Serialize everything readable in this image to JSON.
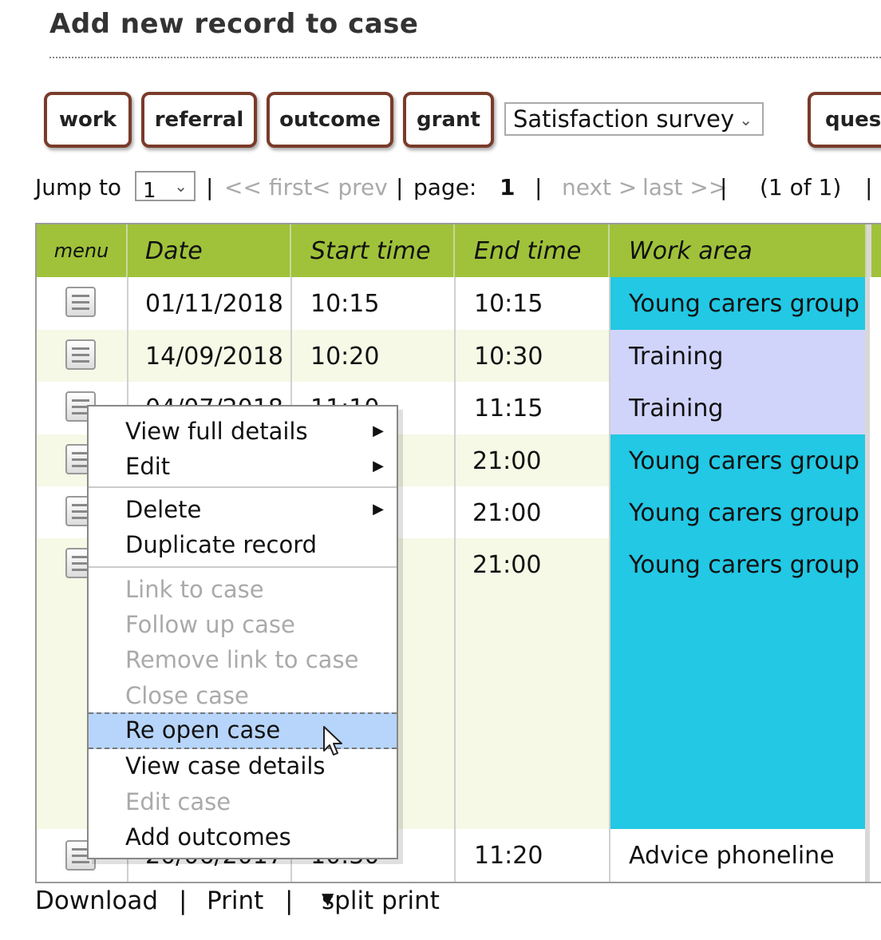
{
  "page": {
    "title": "Add new record to case"
  },
  "buttons": {
    "work": "work",
    "referral": "referral",
    "outcome": "outcome",
    "grant": "grant",
    "quest": "quest"
  },
  "survey_select": {
    "value": "Satisfaction survey"
  },
  "pager": {
    "jump_label": "Jump to",
    "jump_value": "1",
    "sep": "|",
    "first": "<< first",
    "prev": "< prev",
    "page_label": "page:",
    "page_number": "1",
    "next": "next >",
    "last": "last >>",
    "count": "(1 of 1)"
  },
  "table": {
    "headers": [
      "menu",
      "Date",
      "Start time",
      "End time",
      "Work area"
    ],
    "rows": [
      {
        "date": "01/11/2018",
        "start": "10:15",
        "end": "10:15",
        "area": "Young carers group",
        "area_color": "#22c8e4"
      },
      {
        "date": "14/09/2018",
        "start": "10:20",
        "end": "10:30",
        "area": "Training",
        "area_color": "#d0d4fa"
      },
      {
        "date": "04/07/2018",
        "start": "11:10",
        "end": "11:15",
        "area": "Training",
        "area_color": "#d0d4fa"
      },
      {
        "date": "",
        "start": "",
        "end": "21:00",
        "area": "Young carers group",
        "area_color": "#22c8e4"
      },
      {
        "date": "",
        "start": "",
        "end": "21:00",
        "area": "Young carers group",
        "area_color": "#22c8e4"
      },
      {
        "date": "",
        "start": "",
        "end": "21:00",
        "area": "Young carers group",
        "area_color": "#22c8e4"
      },
      {
        "date": "20/06/2017",
        "start": "10:30",
        "end": "11:20",
        "area": "Advice phoneline",
        "area_color": "#ffffff"
      }
    ]
  },
  "context_menu": {
    "items": [
      {
        "label": "View full details",
        "disabled": false,
        "submenu": true
      },
      {
        "label": "Edit",
        "disabled": false,
        "submenu": true
      },
      {
        "label": "Delete",
        "disabled": false,
        "submenu": true
      },
      {
        "label": "Duplicate record",
        "disabled": false,
        "submenu": false
      },
      {
        "label": "Link to case",
        "disabled": true,
        "submenu": false
      },
      {
        "label": "Follow up case",
        "disabled": true,
        "submenu": false
      },
      {
        "label": "Remove link to case",
        "disabled": true,
        "submenu": false
      },
      {
        "label": "Close case",
        "disabled": true,
        "submenu": false
      },
      {
        "label": "Re open case",
        "disabled": false,
        "submenu": false,
        "highlighted": true
      },
      {
        "label": "View case details",
        "disabled": false,
        "submenu": false
      },
      {
        "label": "Edit case",
        "disabled": true,
        "submenu": false
      },
      {
        "label": "Add outcomes",
        "disabled": false,
        "submenu": false
      }
    ]
  },
  "footer": {
    "download": "Download",
    "print": "Print",
    "split_print": "split print",
    "sep": "|"
  },
  "colors": {
    "header_green": "#a0c23a",
    "stripe": "#f5f9e6",
    "button_border": "#7a3b2a"
  }
}
